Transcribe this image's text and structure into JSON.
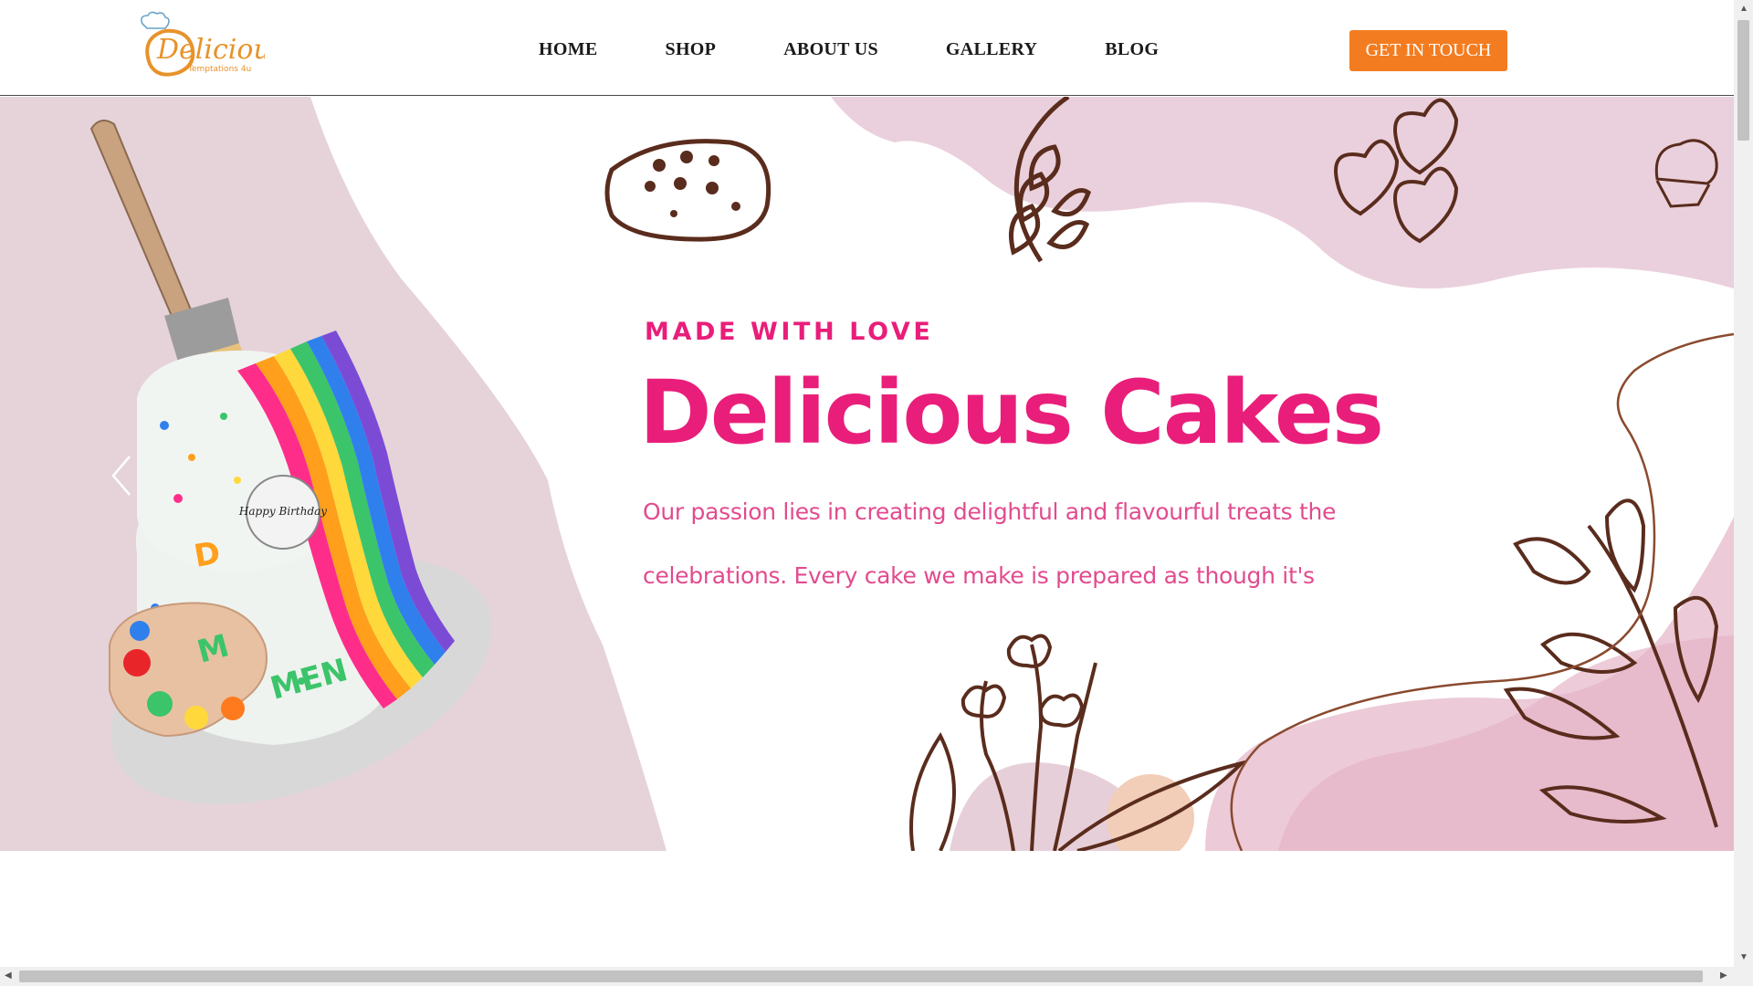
{
  "brand": {
    "logo_name": "Delicious",
    "logo_tagline": "Temptations 4u"
  },
  "nav": {
    "items": [
      {
        "label": "HOME"
      },
      {
        "label": "SHOP"
      },
      {
        "label": "ABOUT US"
      },
      {
        "label": "GALLERY"
      },
      {
        "label": "BLOG"
      }
    ],
    "cta_label": "GET IN TOUCH"
  },
  "hero": {
    "eyebrow": "MADE WITH LOVE",
    "title": "Delicious Cakes",
    "text": "Our passion lies in creating delightful and flavourful treats the celebrations. Every cake we make is prepared as though it's",
    "cake_topper_text": "Happy Birthday",
    "prev_icon": "chevron-left-icon"
  },
  "colors": {
    "accent": "#e91e7a",
    "cta": "#f47c20",
    "logo_orange": "#e8922a",
    "doodle_brown": "#5a2c1d",
    "blob_pink": "#e8c6d4"
  }
}
